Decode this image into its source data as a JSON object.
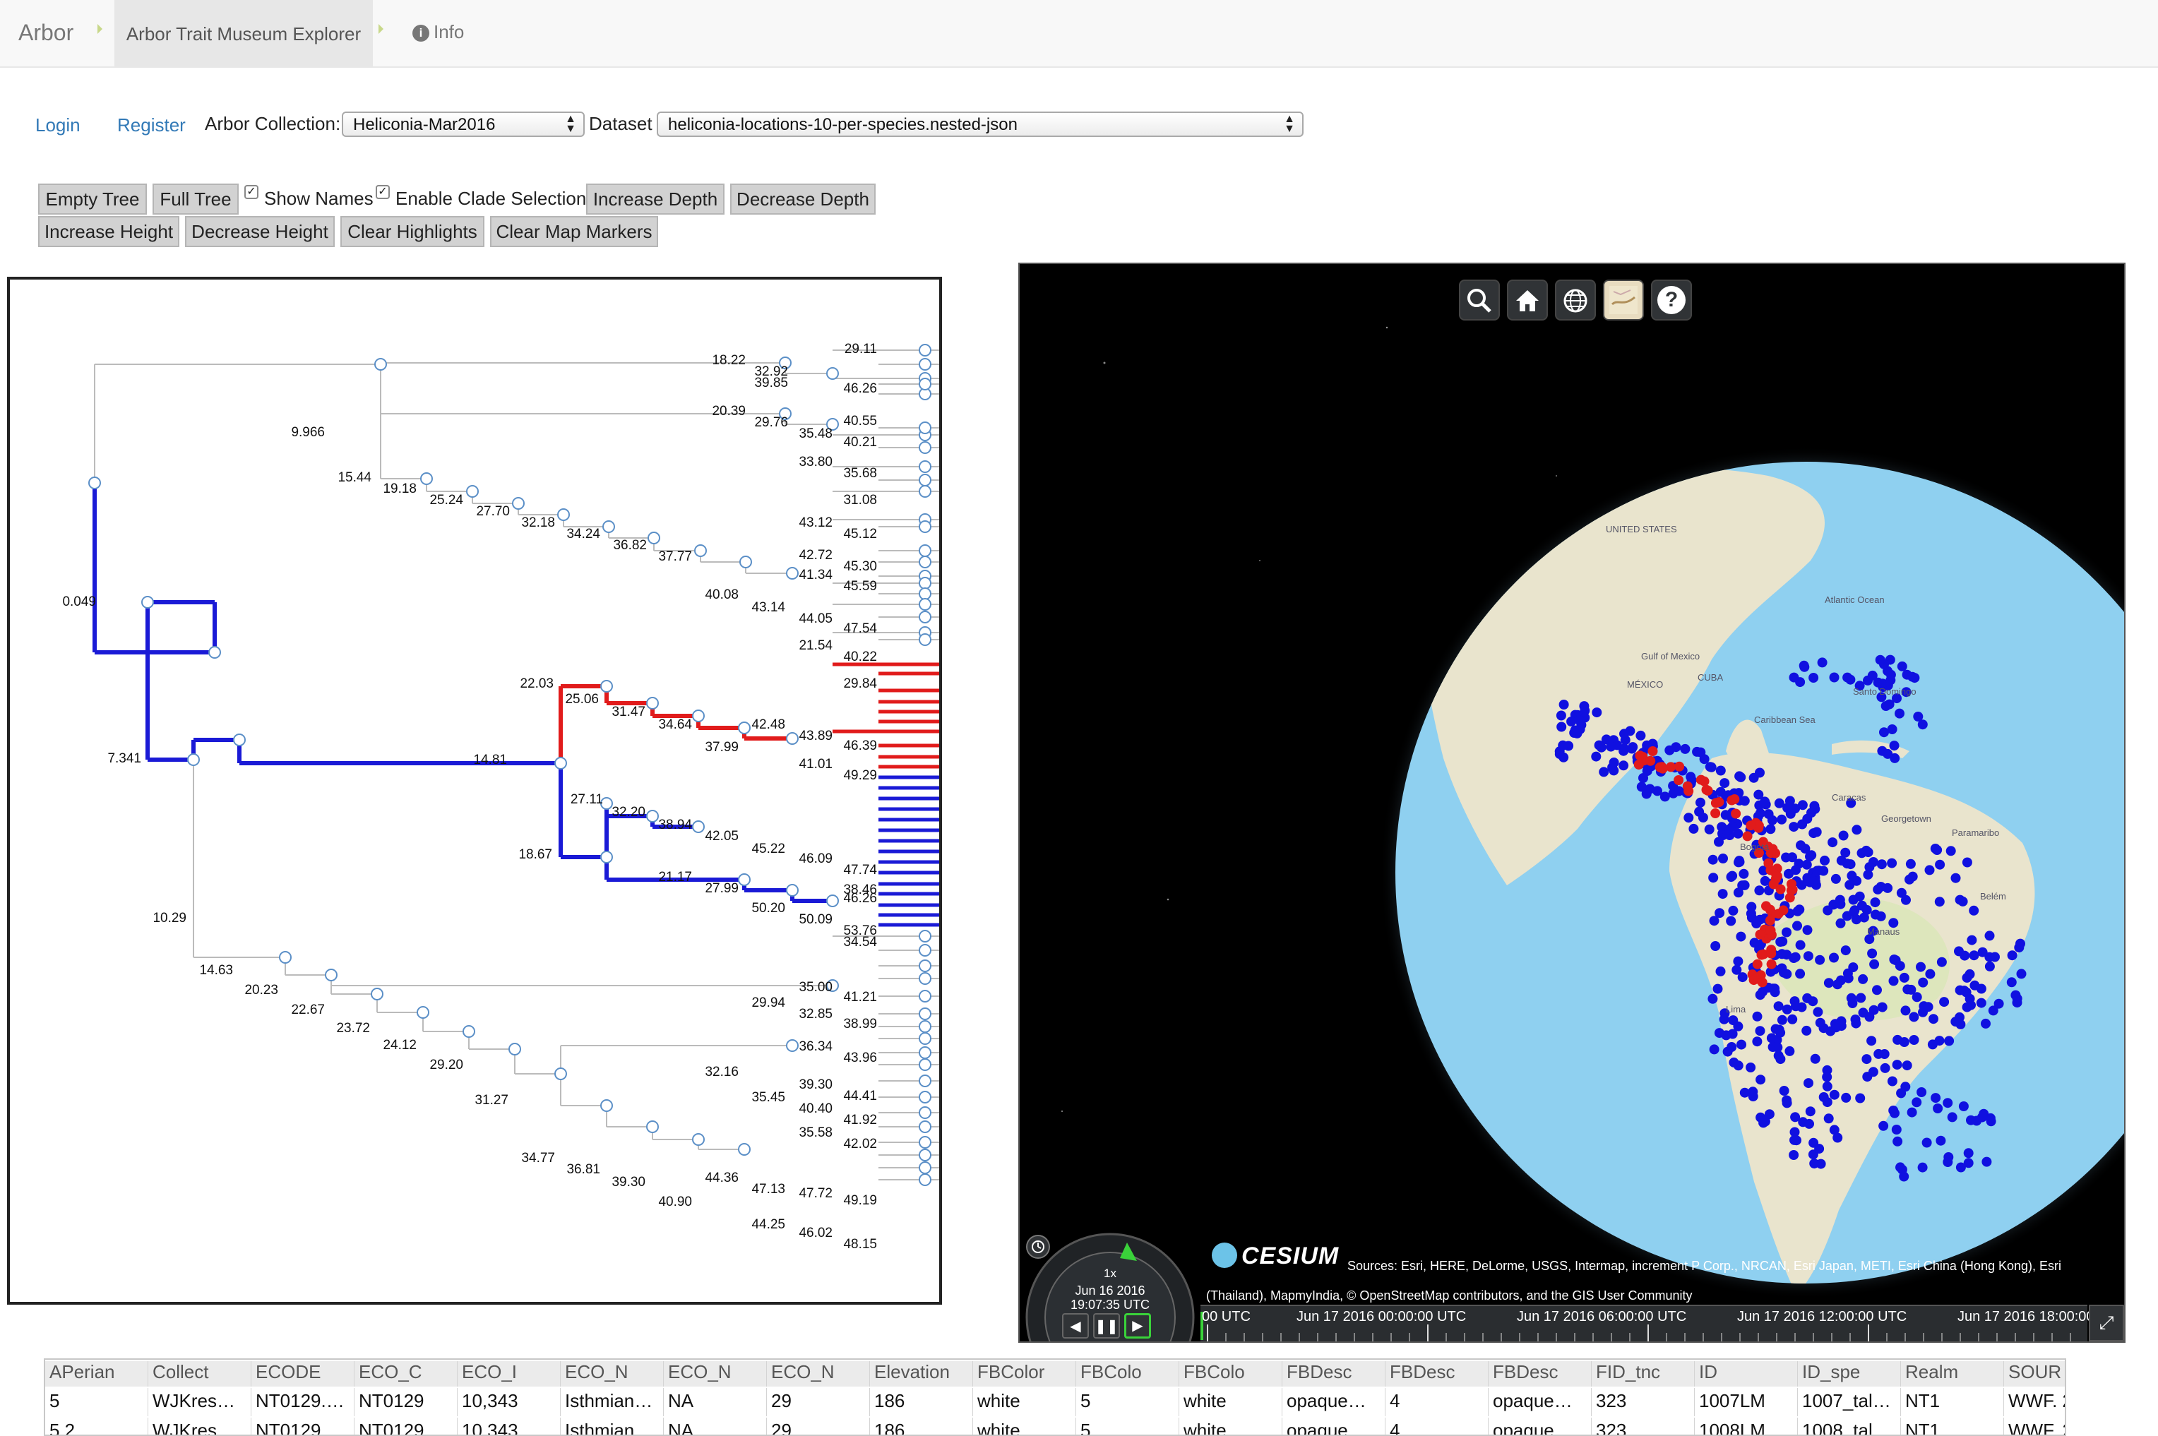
{
  "navbar": {
    "brand": "Arbor",
    "active_crumb": "Arbor Trait Museum Explorer",
    "info": "Info"
  },
  "auth": {
    "login": "Login",
    "register": "Register"
  },
  "collection": {
    "label": "Arbor Collection:",
    "value": "Heliconia-Mar2016"
  },
  "dataset": {
    "label": "Dataset",
    "value": "heliconia-locations-10-per-species.nested-json"
  },
  "toolbar": {
    "empty_tree": "Empty Tree",
    "full_tree": "Full Tree",
    "show_names": "Show Names",
    "enable_clade": "Enable Clade Selection",
    "increase_depth": "Increase Depth",
    "decrease_depth": "Decrease Depth",
    "increase_height": "Increase Height",
    "decrease_height": "Decrease Height",
    "clear_highlights": "Clear Highlights",
    "clear_map_markers": "Clear Map Markers"
  },
  "tree": {
    "labels": [
      "18.22",
      "32.92",
      "29.11",
      "39.85",
      "46.26",
      "20.39",
      "29.76",
      "35.48",
      "40.55",
      "40.21",
      "9.966",
      "33.80",
      "35.68",
      "15.44",
      "19.18",
      "25.24",
      "27.70",
      "31.08",
      "32.18",
      "34.24",
      "43.12",
      "45.12",
      "36.82",
      "42.72",
      "45.30",
      "37.77",
      "41.34",
      "45.59",
      "40.08",
      "43.14",
      "44.05",
      "47.54",
      "0.049",
      "21.54",
      "40.22",
      "22.03",
      "29.84",
      "25.06",
      "31.47",
      "34.64",
      "42.48",
      "43.89",
      "37.99",
      "46.39",
      "41.01",
      "49.29",
      "7.341",
      "14.81",
      "27.11",
      "32.20",
      "38.94",
      "42.05",
      "45.22",
      "46.09",
      "47.74",
      "18.67",
      "38.46",
      "21.17",
      "27.99",
      "46.26",
      "50.20",
      "50.09",
      "53.76",
      "10.29",
      "34.54",
      "14.63",
      "35.00",
      "41.21",
      "20.23",
      "29.94",
      "32.85",
      "38.99",
      "22.67",
      "36.34",
      "43.96",
      "23.72",
      "24.12",
      "39.30",
      "44.41",
      "29.20",
      "32.16",
      "35.45",
      "40.40",
      "41.92",
      "31.27",
      "35.58",
      "42.02",
      "34.77",
      "36.81",
      "44.36",
      "47.13",
      "47.72",
      "39.30",
      "49.19",
      "40.90",
      "44.25",
      "46.02",
      "48.15"
    ]
  },
  "globe": {
    "tools": {
      "search": "search-icon",
      "home": "home-icon",
      "scene": "globe-icon",
      "layers": "map-layers-icon",
      "help": "?"
    },
    "credit_logo": "CESIUM",
    "credit_text": "Sources: Esri, HERE, DeLorme, USGS, Intermap, increment P Corp., NRCAN, Esri Japan, METI, Esri China (Hong Kong), Esri (Thailand), MapmyIndia, © OpenStreetMap contributors, and the GIS User Community",
    "places": [
      "UNITED STATES",
      "Atlantic Ocean",
      "Gulf of Mexico",
      "MÉXICO",
      "CUBA",
      "Caribbean Sea",
      "Santo Domingo",
      "Caracas",
      "Bogotá",
      "Paramaribo",
      "Georgetown",
      "Manaus",
      "Belém",
      "Lima"
    ],
    "animation": {
      "speed": "1x",
      "date": "Jun 16 2016",
      "time": "19:07:35 UTC"
    },
    "timeline": [
      "00 UTC",
      "Jun 17 2016 00:00:00 UTC",
      "Jun 17 2016 06:00:00 UTC",
      "Jun 17 2016 12:00:00 UTC",
      "Jun 17 2016 18:00:00"
    ],
    "colors": {
      "selected": "#e11b1b",
      "marker": "#1010e0",
      "ocean": "#8fd0f0",
      "land": "#eae5cf"
    }
  },
  "table": {
    "columns": [
      "APerian",
      "Collect",
      "ECODE",
      "ECO_C",
      "ECO_I",
      "ECO_N",
      "ECO_N",
      "ECO_N",
      "Elevation",
      "FBColor",
      "FBColo",
      "FBColo",
      "FBDesc",
      "FBDesc",
      "FBDesc",
      "FID_tnc",
      "ID",
      "ID_spe",
      "Realm",
      "SOUR"
    ],
    "rows": [
      [
        "5",
        "WJKres…",
        "NT0129.…",
        "NT0129",
        "10,343",
        "Isthmian…",
        "NA",
        "29",
        "186",
        "white",
        "5",
        "white",
        "opaque…",
        "4",
        "opaque…",
        "323",
        "1007LM",
        "1007_tal…",
        "NT1",
        "WWF. 2…"
      ],
      [
        "5.2",
        "WJKres…",
        "NT0129.…",
        "NT0129",
        "10,343",
        "Isthmian…",
        "NA",
        "29",
        "186",
        "white",
        "5",
        "white",
        "opaque…",
        "4",
        "opaque…",
        "323",
        "1008LM",
        "1008_tal…",
        "NT1",
        "WWF. 2…"
      ]
    ]
  }
}
